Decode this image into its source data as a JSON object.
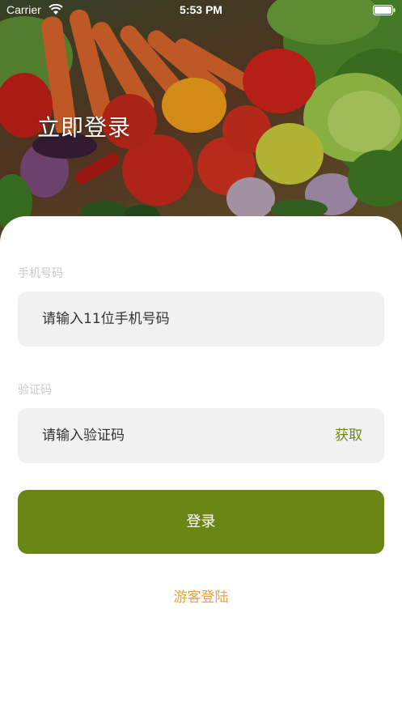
{
  "status_bar": {
    "carrier": "Carrier",
    "time": "5:53 PM"
  },
  "hero": {
    "title": "立即登录"
  },
  "form": {
    "phone": {
      "label": "手机号码",
      "placeholder": "请输入11位手机号码"
    },
    "code": {
      "label": "验证码",
      "placeholder": "请输入验证码",
      "get_code_label": "获取"
    },
    "login_label": "登录",
    "guest_label": "游客登陆"
  },
  "colors": {
    "primary": "#6a8615",
    "accent_green": "#6a8c13",
    "guest_orange": "#f0a032",
    "field_bg": "#f1f1f1"
  }
}
